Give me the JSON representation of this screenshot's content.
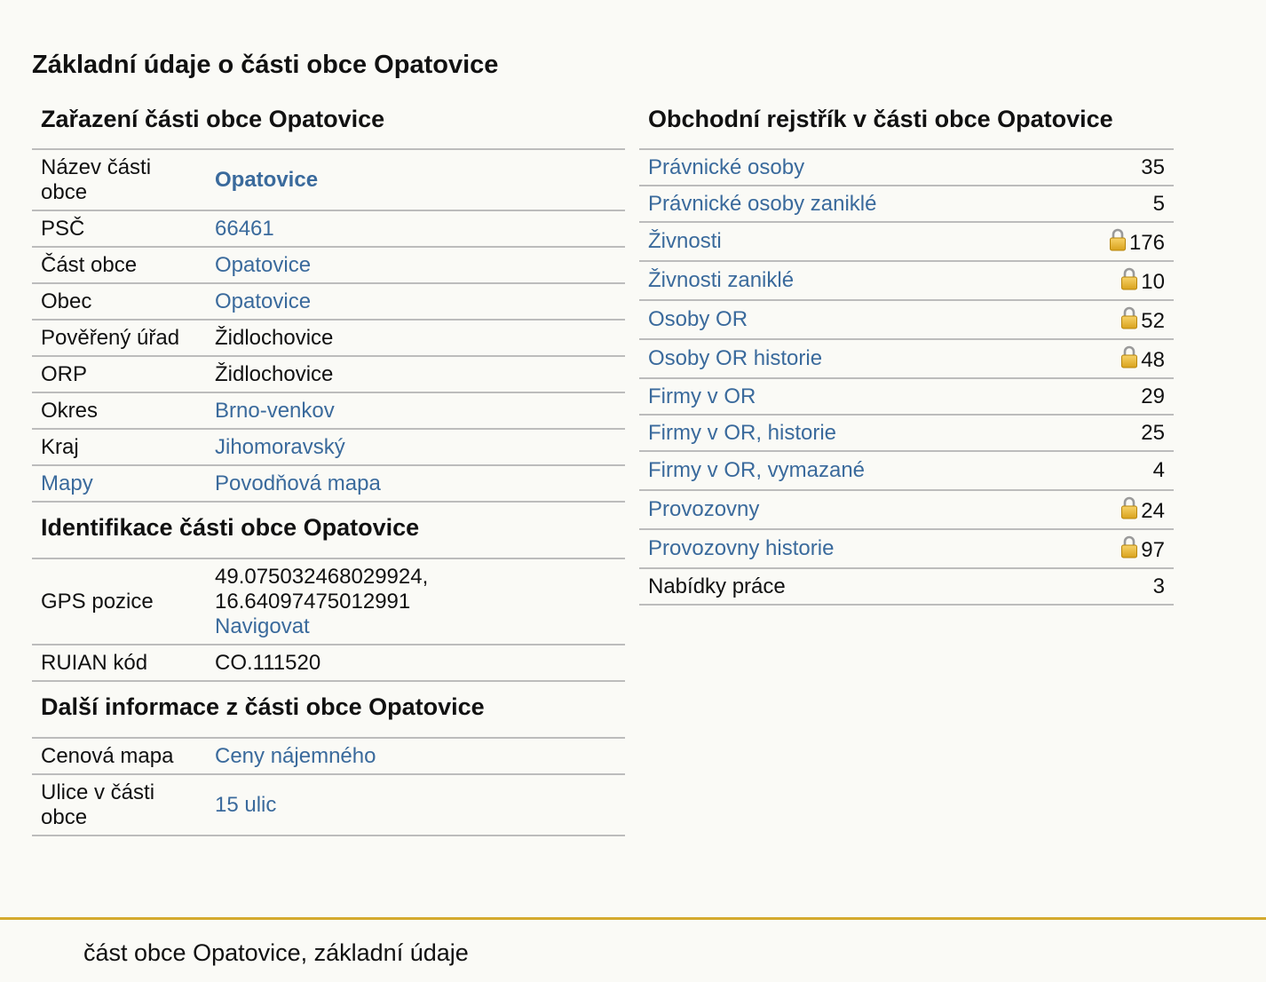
{
  "page": {
    "title": "Základní údaje o části obce Opatovice"
  },
  "classification": {
    "heading": "Zařazení části obce Opatovice",
    "rows": [
      {
        "key": "Název části obce",
        "value": "Opatovice"
      },
      {
        "key": "PSČ",
        "value": "66461"
      },
      {
        "key": "Část obce",
        "value": "Opatovice"
      },
      {
        "key": "Obec",
        "value": "Opatovice"
      },
      {
        "key": "Pověřený úřad",
        "value": "Židlochovice"
      },
      {
        "key": "ORP",
        "value": "Židlochovice"
      },
      {
        "key": "Okres",
        "value": "Brno-venkov"
      },
      {
        "key": "Kraj",
        "value": "Jihomoravský"
      },
      {
        "key": "Mapy",
        "value": "Povodňová mapa"
      }
    ]
  },
  "identification": {
    "heading": "Identifikace části obce Opatovice",
    "gps_label": "GPS pozice",
    "gps_value": "49.075032468029924, 16.64097475012991",
    "navigate_label": "Navigovat",
    "ruian_label": "RUIAN kód",
    "ruian_value": "CO.111520"
  },
  "more_info": {
    "heading": "Další informace z části obce Opatovice",
    "rows": [
      {
        "key": "Cenová mapa",
        "value": "Ceny nájemného"
      },
      {
        "key": "Ulice v části obce",
        "value": "15 ulic"
      }
    ]
  },
  "business_register": {
    "heading": "Obchodní rejstřík v části obce Opatovice",
    "rows": [
      {
        "label": "Právnické osoby",
        "count": "35",
        "locked": false
      },
      {
        "label": "Právnické osoby zaniklé",
        "count": "5",
        "locked": false
      },
      {
        "label": "Živnosti",
        "count": "176",
        "locked": true
      },
      {
        "label": "Živnosti zaniklé",
        "count": "10",
        "locked": true
      },
      {
        "label": "Osoby OR",
        "count": "52",
        "locked": true
      },
      {
        "label": "Osoby OR historie",
        "count": "48",
        "locked": true
      },
      {
        "label": "Firmy v OR",
        "count": "29",
        "locked": false
      },
      {
        "label": "Firmy v OR, historie",
        "count": "25",
        "locked": false
      },
      {
        "label": "Firmy v OR, vymazané",
        "count": "4",
        "locked": false
      },
      {
        "label": "Provozovny",
        "count": "24",
        "locked": true
      },
      {
        "label": "Provozovny historie",
        "count": "97",
        "locked": true
      },
      {
        "label": "Nabídky práce",
        "count": "3",
        "locked": false
      }
    ]
  },
  "footer": {
    "text": "část obce Opatovice, základní údaje"
  },
  "colors": {
    "link": "#3a6a9c",
    "footer_line": "#d4aa2e",
    "row_border": "#bcbcbc",
    "background": "#fafaf6"
  },
  "icons": {
    "lock": "lock-icon"
  }
}
